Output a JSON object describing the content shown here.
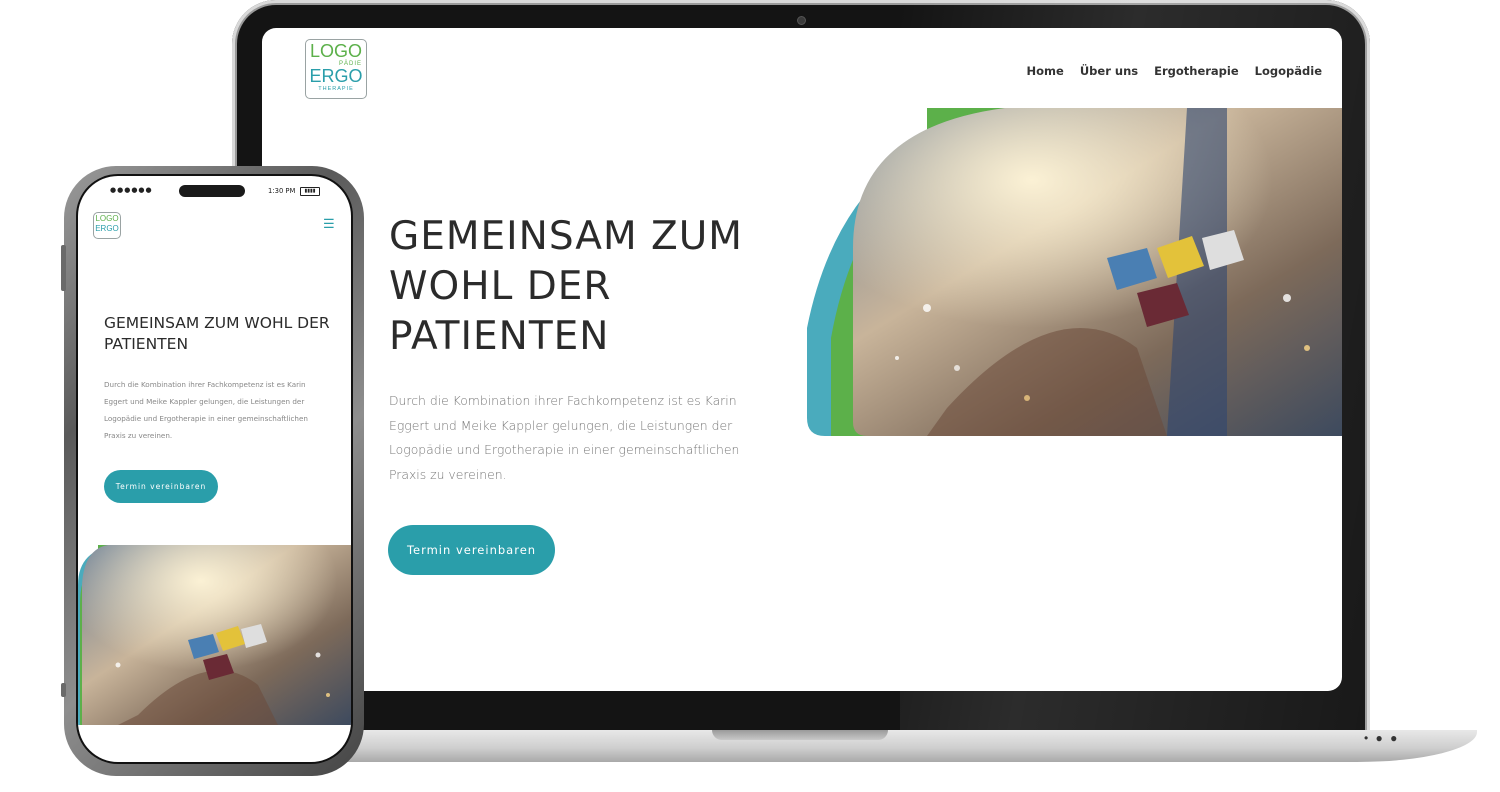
{
  "logo": {
    "line1": "LOGO",
    "line1_sub": "PÄDIE",
    "line2": "ERGO",
    "line2_sub": "THERAPIE"
  },
  "nav": {
    "items": [
      {
        "label": "Home"
      },
      {
        "label": "Über uns"
      },
      {
        "label": "Ergotherapie"
      },
      {
        "label": "Logopädie"
      }
    ]
  },
  "hero": {
    "title": "GEMEINSAM ZUM WOHL DER PATIENTEN",
    "text": "Durch die Kombination ihrer Fachkompetenz ist es Karin Eggert und Meike Kappler gelungen, die Leistungen der Logopädie und Ergotherapie in einer gemeinschaftlichen Praxis zu vereinen.",
    "cta_label": "Termin vereinbaren"
  },
  "phone_status": {
    "signal": "●●●●●●",
    "time": "1:30 PM"
  },
  "menu_icon": "hamburger-menu-icon",
  "colors": {
    "green": "#5cb04a",
    "teal": "#2a9eaa",
    "blue_arc": "#4aabbd",
    "text_dark": "#2b2b2b"
  }
}
